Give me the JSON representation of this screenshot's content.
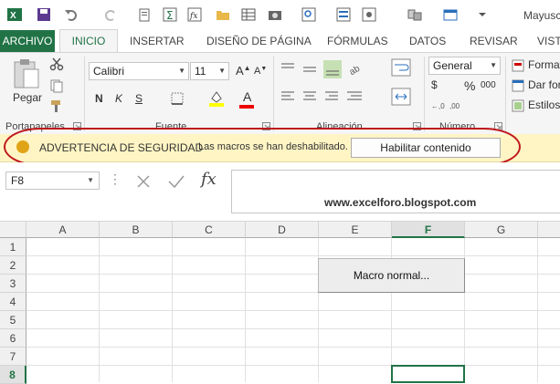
{
  "window": {
    "title": "Mayusc"
  },
  "quick_access": {
    "icons": [
      "excel-logo-icon",
      "save-icon",
      "undo-icon",
      "redo-icon",
      "paste-icon",
      "sigma-icon",
      "fx-icon",
      "open-folder-icon",
      "table-icon",
      "camera-icon",
      "zoom-icon",
      "form-icon",
      "shapes-icon",
      "window-icon",
      "print-icon"
    ]
  },
  "tabs": [
    "ARCHIVO",
    "INICIO",
    "INSERTAR",
    "DISEÑO DE PÁGINA",
    "FÓRMULAS",
    "DATOS",
    "REVISAR",
    "VISTA"
  ],
  "ribbon": {
    "clipboard": {
      "paste_label": "Pegar",
      "group_label": "Portapapeles"
    },
    "font": {
      "font_name": "Calibri",
      "font_size": "11",
      "bold": "N",
      "italic": "K",
      "underline": "S",
      "group_label": "Fuente",
      "grow": "A",
      "shrink": "A",
      "font_color_letter": "A"
    },
    "alignment": {
      "group_label": "Alineación"
    },
    "number": {
      "format": "General",
      "currency": "$",
      "percent": "%",
      "thousands": "000",
      "group_label": "Número"
    },
    "styles": {
      "items": [
        "Formato",
        "Dar for",
        "Estilos"
      ]
    }
  },
  "security_bar": {
    "title": "ADVERTENCIA DE SEGURIDAD",
    "message": "Las macros se han deshabilitado.",
    "button": "Habilitar contenido"
  },
  "formula_bar": {
    "name_box": "F8",
    "fx": "fx",
    "content": "www.excelforo.blogspot.com"
  },
  "grid": {
    "columns": [
      "A",
      "B",
      "C",
      "D",
      "E",
      "F",
      "G"
    ],
    "rows": [
      "1",
      "2",
      "3",
      "4",
      "5",
      "6",
      "7",
      "8"
    ],
    "active_column": "F",
    "active_row": "8",
    "macro_button_label": "Macro normal..."
  },
  "colors": {
    "accent": "#217346",
    "security_bg": "#fff5c4",
    "highlight_oval": "#c0181c"
  }
}
